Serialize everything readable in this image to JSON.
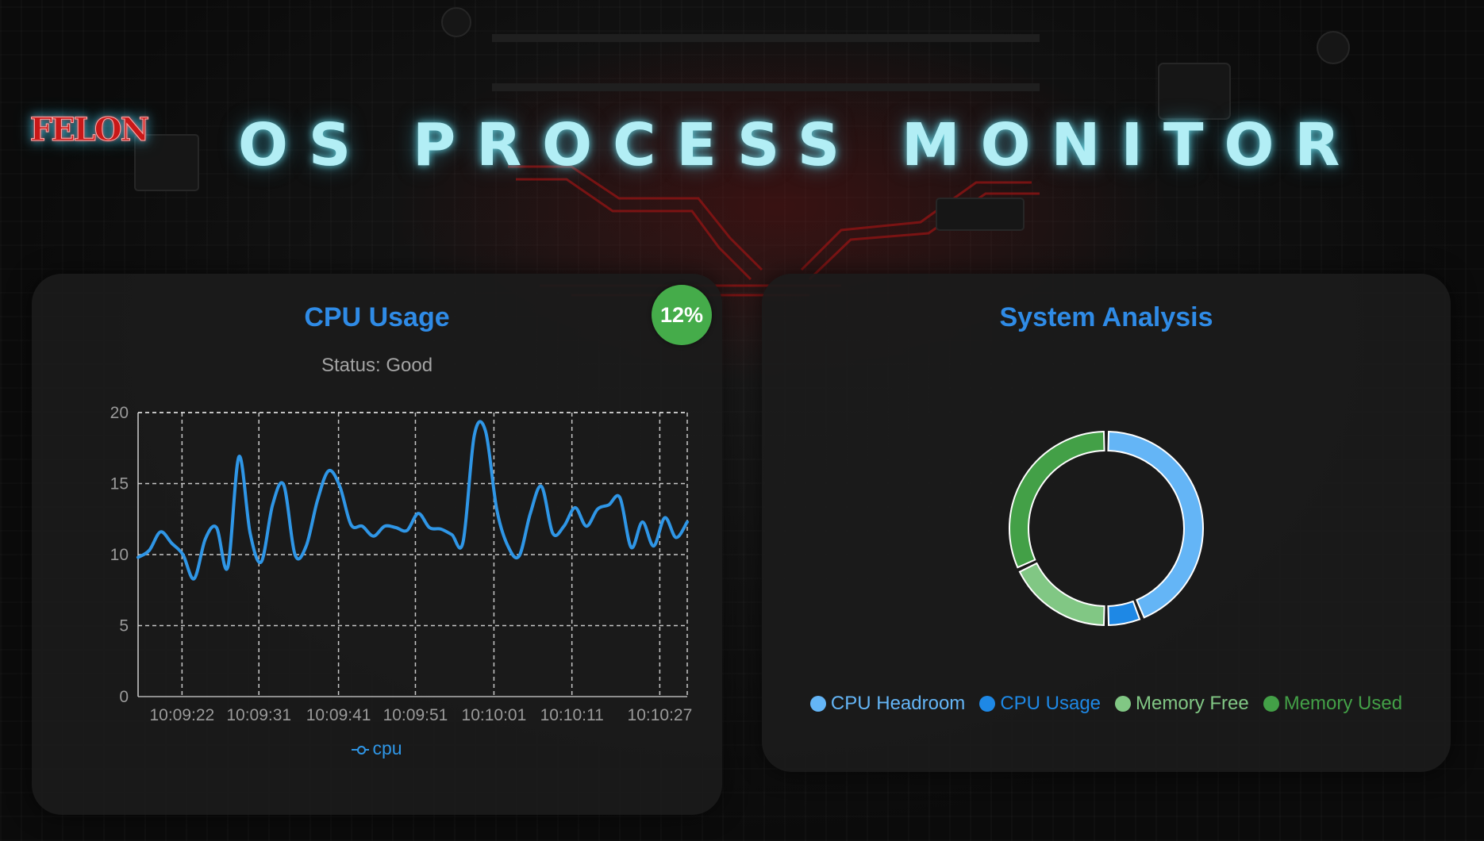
{
  "header": {
    "logo_text": "FELON",
    "title": "OS PROCESS MONITOR"
  },
  "cpu_panel": {
    "title": "CPU Usage",
    "status": "Status: Good",
    "badge": "12%",
    "badge_color": "#45ac4a",
    "legend_label": "cpu"
  },
  "system_panel": {
    "title": "System Analysis",
    "legend": [
      {
        "label": "CPU Headroom",
        "color": "#64b5f6"
      },
      {
        "label": "CPU Usage",
        "color": "#1e88e5"
      },
      {
        "label": "Memory Free",
        "color": "#81c784"
      },
      {
        "label": "Memory Used",
        "color": "#43a047"
      }
    ]
  },
  "chart_data": [
    {
      "type": "line",
      "title": "CPU Usage",
      "xlabel": "",
      "ylabel": "",
      "ylim": [
        0,
        20
      ],
      "yticks": [
        0,
        5,
        10,
        15,
        20
      ],
      "grid": true,
      "legend_position": "bottom",
      "x_tick_labels": [
        "10:09:22",
        "10:09:31",
        "10:09:41",
        "10:09:51",
        "10:10:01",
        "10:10:11",
        "10:10:27"
      ],
      "series": [
        {
          "name": "cpu",
          "color": "#2f96e6",
          "values": [
            9.8,
            10.3,
            11.6,
            10.8,
            10.0,
            8.3,
            11.1,
            11.9,
            9.1,
            16.9,
            11.5,
            9.5,
            13.5,
            14.9,
            10.0,
            10.6,
            13.8,
            15.9,
            14.8,
            12.1,
            12.0,
            11.3,
            12.0,
            11.9,
            11.7,
            12.9,
            11.9,
            11.8,
            11.4,
            10.9,
            18.4,
            18.7,
            13.2,
            10.6,
            9.9,
            12.9,
            14.8,
            11.5,
            12.0,
            13.3,
            12.0,
            13.2,
            13.5,
            14.0,
            10.5,
            12.3,
            10.6,
            12.6,
            11.2,
            12.3
          ]
        }
      ]
    },
    {
      "type": "pie",
      "title": "System Analysis",
      "style": "doughnut",
      "categories": [
        "CPU Headroom",
        "CPU Usage",
        "Memory Free",
        "Memory Used"
      ],
      "values": [
        44,
        6,
        18,
        32
      ],
      "colors": [
        "#64b5f6",
        "#1e88e5",
        "#81c784",
        "#43a047"
      ]
    }
  ]
}
